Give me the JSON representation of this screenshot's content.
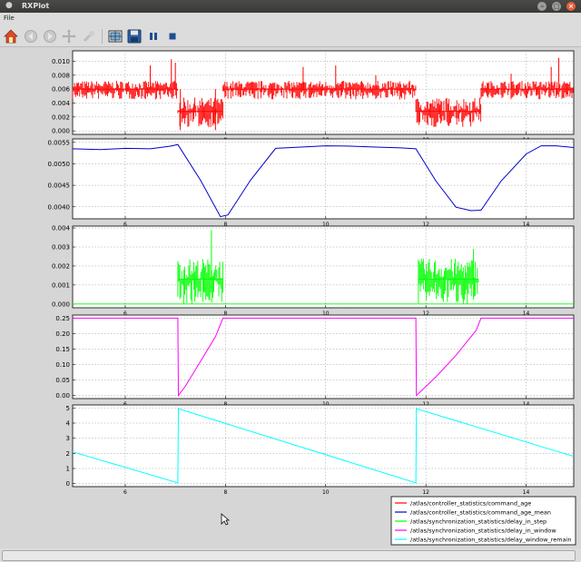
{
  "window": {
    "title": "RXPlot"
  },
  "menubar": {
    "file_label": "File"
  },
  "toolbar": {
    "icons": [
      "home-icon",
      "back-icon",
      "forward-icon",
      "pan-icon",
      "zoom-icon",
      "subplots-icon",
      "save-icon",
      "pause-icon",
      "stop-icon"
    ]
  },
  "colors": {
    "command_age": "#ff0000",
    "command_age_mean": "#0000cc",
    "delay_in_step": "#00ff00",
    "delay_in_window": "#ff00ff",
    "delay_window_remain": "#00ffff"
  },
  "legend": {
    "entries": [
      "/atlas/controller_statistics/command_age",
      "/atlas/controller_statistics/command_age_mean",
      "/atlas/synchronization_statistics/delay_in_step",
      "/atlas/synchronization_statistics/delay_in_window",
      "/atlas/synchronization_statistics/delay_window_remain"
    ]
  },
  "chart_data": [
    {
      "type": "line",
      "series": [
        {
          "name": "/atlas/controller_statistics/command_age",
          "color": "#ff0000"
        }
      ],
      "xlim": [
        4.95,
        14.95
      ],
      "ylim": [
        -0.0005,
        0.0115
      ],
      "xticks": [
        "6",
        "8",
        "10",
        "12",
        "14"
      ],
      "yticks": [
        "0.000",
        "0.002",
        "0.004",
        "0.006",
        "0.008",
        "0.010"
      ],
      "grid": true,
      "segments": [
        {
          "x": [
            4.95,
            7.05
          ],
          "base": 0.006,
          "low": 0.0045,
          "high": 0.0072
        },
        {
          "x": [
            7.05,
            7.95
          ],
          "base": 0.0028,
          "low": 0.0005,
          "high": 0.0048
        },
        {
          "x": [
            7.95,
            11.8
          ],
          "base": 0.006,
          "low": 0.0045,
          "high": 0.0072
        },
        {
          "x": [
            11.8,
            13.1
          ],
          "base": 0.0028,
          "low": 0.0005,
          "high": 0.0048
        },
        {
          "x": [
            13.1,
            14.95
          ],
          "base": 0.006,
          "low": 0.0045,
          "high": 0.0072
        }
      ],
      "spikes": [
        {
          "x": 6.5,
          "y": 0.0094
        },
        {
          "x": 6.92,
          "y": 0.0103
        },
        {
          "x": 7.0,
          "y": 0.0098
        },
        {
          "x": 7.1,
          "y": 0.0001
        },
        {
          "x": 7.8,
          "y": 0.0001
        },
        {
          "x": 9.55,
          "y": 0.0092
        },
        {
          "x": 10.2,
          "y": 0.0094
        },
        {
          "x": 11.0,
          "y": 0.008
        },
        {
          "x": 13.7,
          "y": 0.0082
        },
        {
          "x": 14.65,
          "y": 0.0105
        },
        {
          "x": 14.5,
          "y": 0.0092
        }
      ]
    },
    {
      "type": "line",
      "series": [
        {
          "name": "/atlas/controller_statistics/command_age_mean",
          "color": "#0000cc"
        }
      ],
      "xlim": [
        4.95,
        14.95
      ],
      "ylim": [
        0.00372,
        0.00558
      ],
      "xticks": [
        "6",
        "8",
        "10",
        "12",
        "14"
      ],
      "yticks": [
        "0.0040",
        "0.0045",
        "0.0050",
        "0.0055"
      ],
      "grid": true,
      "x": [
        4.95,
        5.5,
        6.0,
        6.5,
        6.9,
        7.05,
        7.5,
        7.9,
        8.05,
        8.5,
        9.0,
        9.5,
        10.0,
        10.5,
        11.0,
        11.5,
        11.8,
        12.2,
        12.6,
        12.9,
        13.1,
        13.5,
        14.0,
        14.3,
        14.6,
        14.95
      ],
      "y": [
        0.00535,
        0.00533,
        0.00536,
        0.00535,
        0.00541,
        0.00545,
        0.00462,
        0.00377,
        0.00381,
        0.00462,
        0.00536,
        0.00539,
        0.00542,
        0.00541,
        0.00539,
        0.00537,
        0.00535,
        0.0046,
        0.00399,
        0.00391,
        0.00392,
        0.0046,
        0.00523,
        0.00542,
        0.00542,
        0.00538
      ]
    },
    {
      "type": "line",
      "series": [
        {
          "name": "/atlas/synchronization_statistics/delay_in_step",
          "color": "#00ff00"
        }
      ],
      "xlim": [
        4.95,
        14.95
      ],
      "ylim": [
        -0.0002,
        0.0041
      ],
      "xticks": [
        "6",
        "8",
        "10",
        "12",
        "14"
      ],
      "yticks": [
        "0.000",
        "0.001",
        "0.002",
        "0.003",
        "0.004"
      ],
      "grid": true,
      "segments": [
        {
          "x": [
            7.05,
            7.95
          ],
          "base": 0.0013,
          "low": 0.0,
          "high": 0.0024
        },
        {
          "x": [
            11.85,
            13.05
          ],
          "base": 0.0013,
          "low": 0.0,
          "high": 0.0024
        }
      ],
      "spikes": [
        {
          "x": 7.72,
          "y": 0.0039
        },
        {
          "x": 12.95,
          "y": 0.0029
        }
      ]
    },
    {
      "type": "line",
      "series": [
        {
          "name": "/atlas/synchronization_statistics/delay_in_window",
          "color": "#ff00ff"
        }
      ],
      "xlim": [
        4.95,
        14.95
      ],
      "ylim": [
        -0.01,
        0.26
      ],
      "xticks": [
        "6",
        "8",
        "10",
        "12",
        "14"
      ],
      "yticks": [
        "0.00",
        "0.05",
        "0.10",
        "0.15",
        "0.20",
        "0.25"
      ],
      "grid": true,
      "x": [
        4.95,
        7.05,
        7.06,
        7.2,
        7.5,
        7.8,
        7.95,
        11.8,
        11.81,
        12.2,
        12.6,
        13.0,
        13.1,
        14.95
      ],
      "y": [
        0.25,
        0.25,
        0.0,
        0.03,
        0.11,
        0.19,
        0.25,
        0.25,
        0.0,
        0.06,
        0.13,
        0.21,
        0.25,
        0.25
      ]
    },
    {
      "type": "line",
      "series": [
        {
          "name": "/atlas/synchronization_statistics/delay_window_remain",
          "color": "#00ffff"
        }
      ],
      "xlim": [
        4.95,
        14.95
      ],
      "ylim": [
        -0.2,
        5.2
      ],
      "xticks": [
        "6",
        "8",
        "10",
        "12",
        "14"
      ],
      "yticks": [
        "0",
        "1",
        "2",
        "3",
        "4",
        "5"
      ],
      "grid": true,
      "x": [
        4.95,
        7.05,
        7.06,
        11.8,
        11.81,
        14.95
      ],
      "y": [
        2.1,
        0.05,
        4.95,
        0.05,
        4.95,
        1.8
      ]
    }
  ]
}
